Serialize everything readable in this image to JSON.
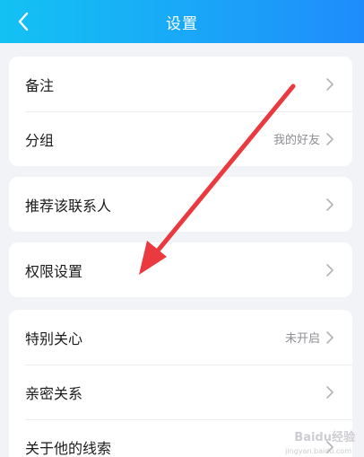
{
  "header": {
    "title": "设置"
  },
  "groups": [
    {
      "rows": [
        {
          "label": "备注",
          "value": ""
        },
        {
          "label": "分组",
          "value": "我的好友"
        }
      ]
    },
    {
      "rows": [
        {
          "label": "推荐该联系人",
          "value": ""
        }
      ]
    },
    {
      "rows": [
        {
          "label": "权限设置",
          "value": ""
        }
      ]
    },
    {
      "rows": [
        {
          "label": "特别关心",
          "value": "未开启"
        },
        {
          "label": "亲密关系",
          "value": ""
        },
        {
          "label": "关于他的线索",
          "value": ""
        }
      ]
    }
  ],
  "annotation": {
    "color": "#ea3a3f"
  },
  "watermark": {
    "text": "Baidu经验",
    "sub": "jingyan.baidu.com"
  },
  "colors": {
    "header_start": "#13c2f3",
    "header_end": "#1f8cfb",
    "background": "#f2f3f6"
  }
}
